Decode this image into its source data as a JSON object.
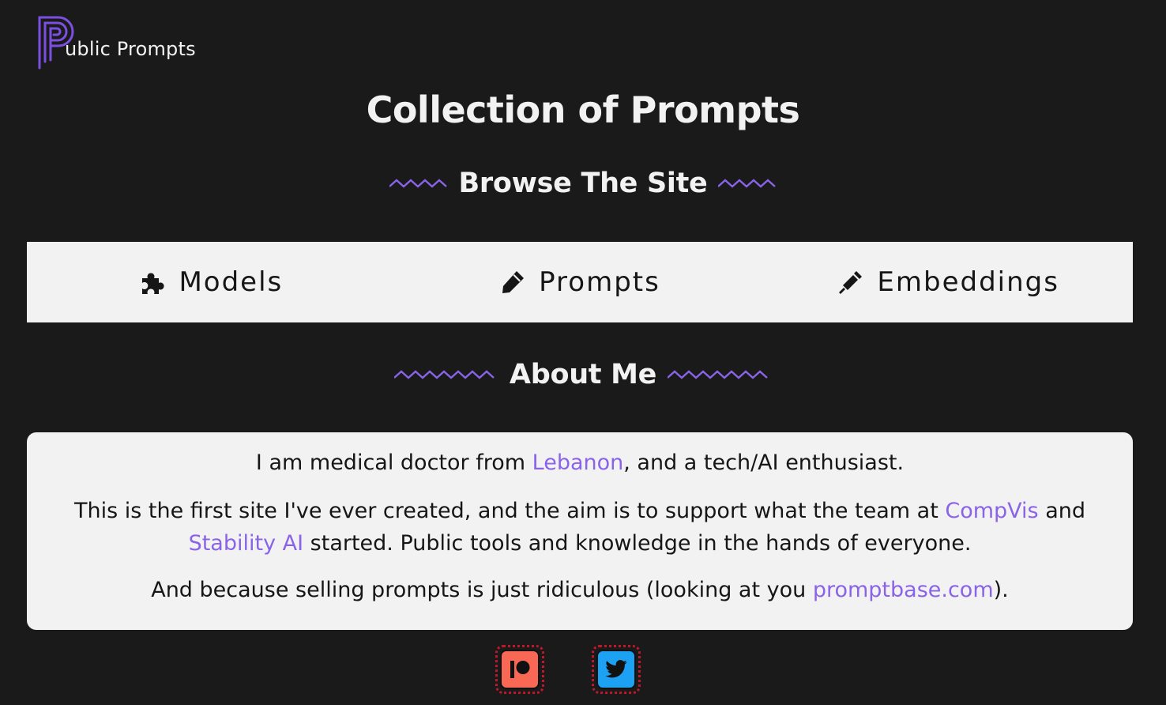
{
  "brand": {
    "logo_text": "ublic Prompts",
    "accent_color": "#8a63e8"
  },
  "page": {
    "title": "Collection of  Prompts"
  },
  "browse": {
    "heading": "Browse The Site",
    "items": [
      {
        "label": "Models",
        "icon": "puzzle-icon"
      },
      {
        "label": "Prompts",
        "icon": "pencil-icon"
      },
      {
        "label": "Embeddings",
        "icon": "syringe-icon"
      }
    ]
  },
  "about": {
    "heading": "About Me",
    "line1_before": "I am medical doctor from ",
    "line1_link": "Lebanon",
    "line1_after": ", and a tech/AI enthusiast.",
    "line2_before": "This is the first site I've ever created, and the aim is to support what the team at ",
    "line2_link1": "CompVis",
    "line2_mid": " and ",
    "line2_link2": "Stability AI",
    "line2_after": " started. Public tools and knowledge in the hands of everyone.",
    "line3_before": "And because selling prompts is just ridiculous (looking at you ",
    "line3_link": "promptbase.com",
    "line3_after": ")."
  },
  "social": [
    {
      "name": "patreon-icon",
      "color": "#f96854"
    },
    {
      "name": "twitter-icon",
      "color": "#1da1f2"
    }
  ]
}
